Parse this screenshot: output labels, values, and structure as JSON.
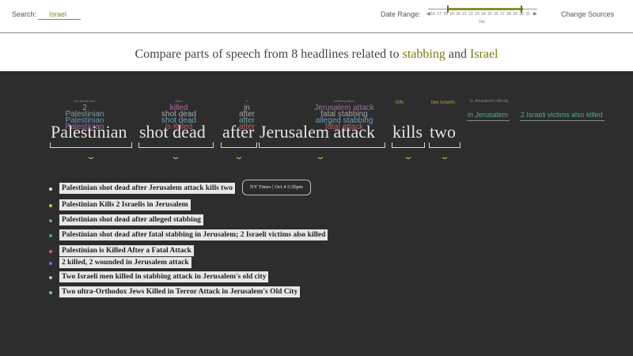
{
  "search": {
    "label": "Search:",
    "value": "Israel"
  },
  "date_range": {
    "label": "Date Range:",
    "days": [
      "16",
      "17",
      "18",
      "19",
      "20",
      "21",
      "22",
      "23",
      "24",
      "25",
      "26",
      "27",
      "28",
      "29",
      "30",
      "31"
    ],
    "month": "Oct",
    "accent": "#8a8f2a"
  },
  "change_sources_label": "Change Sources",
  "subtitle": {
    "prefix": "Compare parts of speech from 8 headlines related to",
    "keyword1": "stabbing",
    "joiner": "and",
    "keyword2": "Israel"
  },
  "stacks": [
    {
      "tiny": "two Israeli men",
      "words": [
        {
          "text": "2",
          "color": "#7fa7c8"
        },
        {
          "text": "Palestinian",
          "color": "#7f9fa0"
        },
        {
          "text": "Palestinian",
          "color": "#6d8fb3"
        },
        {
          "text": "Palestinian",
          "color": "#a06fa0"
        }
      ]
    },
    {
      "tiny": "killed",
      "words": [
        {
          "text": "killed",
          "color": "#b06aa0"
        },
        {
          "text": "shot dead",
          "color": "#a8a8a8"
        },
        {
          "text": "shot dead",
          "color": "#6d9fc0"
        },
        {
          "text": "is Killed",
          "color": "#b06060"
        }
      ]
    },
    {
      "tiny": "in",
      "words": [
        {
          "text": "in",
          "color": "#a8a8a8"
        },
        {
          "text": "after",
          "color": "#a8a8a8"
        },
        {
          "text": "after",
          "color": "#6fa0a0"
        },
        {
          "text": "after",
          "color": "#b06060"
        }
      ]
    },
    {
      "tiny": "stabbing attack",
      "words": [
        {
          "text": "Jerusalem attack",
          "color": "#a070a0"
        },
        {
          "text": "fatal stabbing",
          "color": "#a8a8a8"
        },
        {
          "text": "alleged stabbing",
          "color": "#6d9fc0"
        },
        {
          "text": "fatal attack",
          "color": "#b06060"
        }
      ]
    }
  ],
  "segments": [
    "Palestinian",
    "shot dead",
    "after",
    "Jerusalem attack",
    "kills",
    "two"
  ],
  "side_labels": {
    "kills_top": "kills",
    "two_top": "two Israelis",
    "jerusalem_tiny": "in Jerusalem's old city",
    "jerusalem": "in Jerusalem",
    "victims": "2 Israeli victims also killed"
  },
  "headlines": [
    {
      "text": "Palestinian shot dead after Jerusalem attack kills two",
      "dot": "#e8e8e8"
    },
    {
      "text": "Palestinian Kills 2 Israelis in Jerusalem",
      "dot": "#d4c04a"
    },
    {
      "text": "Palestinian shot dead after alleged stabbing",
      "dot": "#5a9fd4"
    },
    {
      "text": "Palestinian shot dead after fatal stabbing in Jerusalem; 2 Israeli victims also killed",
      "dot": "#4aa87a"
    },
    {
      "text": "Palestinian is Killed After a Fatal Attack",
      "dot": "#d46060"
    },
    {
      "text": "2 killed, 2 wounded in Jerusalem attack",
      "dot": "#a060c0"
    },
    {
      "text": "Two Israeli men killed in stabbing attack in Jerusalem's old city",
      "dot": "#c0c0c0"
    },
    {
      "text": "Two ultra-Orthodox Jews Killed in Terror Attack in Jerusalem's Old City",
      "dot": "#4ad4a0"
    }
  ],
  "tooltip": "NY Times | Oct 4 5:30pm"
}
